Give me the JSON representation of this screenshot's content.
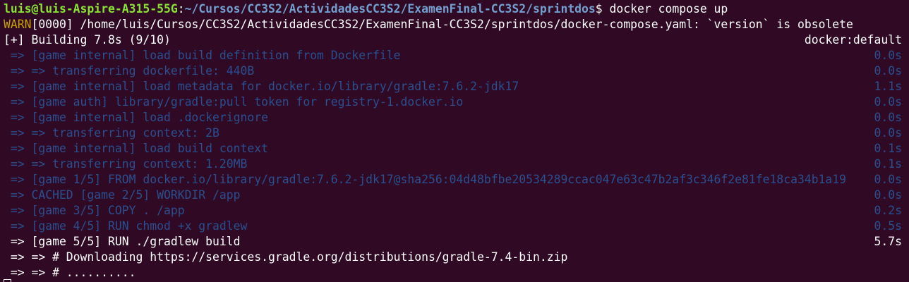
{
  "prompt": {
    "user_host": "luis@luis-Aspire-A315-55G",
    "separator": ":",
    "cwd": "~/Cursos/CC3S2/ActividadesCC3S2/ExamenFinal-CC3S2/sprintdos",
    "symbol": "$",
    "command": " docker compose up"
  },
  "warning": {
    "tag": "WARN",
    "message": "[0000] /home/luis/Cursos/CC3S2/ActividadesCC3S2/ExamenFinal-CC3S2/sprintdos/docker-compose.yaml: `version` is obsolete"
  },
  "build_header": {
    "text": "[+] Building 7.8s (9/10)",
    "context": "docker:default"
  },
  "steps": [
    {
      "text": " => [game internal] load build definition from Dockerfile",
      "time": "0.0s",
      "state": "done"
    },
    {
      "text": " => => transferring dockerfile: 440B",
      "time": "0.0s",
      "state": "done"
    },
    {
      "text": " => [game internal] load metadata for docker.io/library/gradle:7.6.2-jdk17",
      "time": "1.1s",
      "state": "done"
    },
    {
      "text": " => [game auth] library/gradle:pull token for registry-1.docker.io",
      "time": "0.0s",
      "state": "done"
    },
    {
      "text": " => [game internal] load .dockerignore",
      "time": "0.0s",
      "state": "done"
    },
    {
      "text": " => => transferring context: 2B",
      "time": "0.0s",
      "state": "done"
    },
    {
      "text": " => [game internal] load build context",
      "time": "0.1s",
      "state": "done"
    },
    {
      "text": " => => transferring context: 1.20MB",
      "time": "0.1s",
      "state": "done"
    },
    {
      "text": " => [game 1/5] FROM docker.io/library/gradle:7.6.2-jdk17@sha256:04d48bfbe20534289ccac047e63c47b2af3c346f2e81fe18ca34b1a19",
      "time": "0.0s",
      "state": "done"
    },
    {
      "text": " => CACHED [game 2/5] WORKDIR /app",
      "time": "0.0s",
      "state": "done"
    },
    {
      "text": " => [game 3/5] COPY . /app",
      "time": "0.2s",
      "state": "done"
    },
    {
      "text": " => [game 4/5] RUN chmod +x gradlew",
      "time": "0.5s",
      "state": "done"
    },
    {
      "text": " => [game 5/5] RUN ./gradlew build",
      "time": "5.7s",
      "state": "active"
    },
    {
      "text": " => => # Downloading https://services.gradle.org/distributions/gradle-7.4-bin.zip",
      "time": "",
      "state": "active"
    },
    {
      "text": " => => # ..........",
      "time": "",
      "state": "active"
    }
  ],
  "colors": {
    "background": "#300a24",
    "user_host": "#8ae234",
    "path": "#729fcf",
    "warn": "#c4a000",
    "done_step": "#2a4f8f",
    "active_step": "#ffffff"
  }
}
